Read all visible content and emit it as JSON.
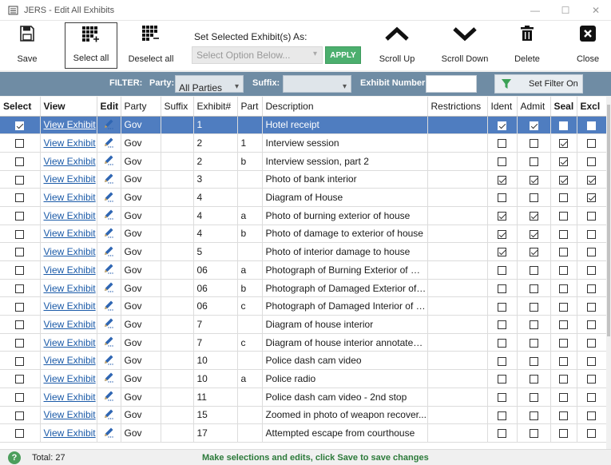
{
  "window": {
    "title": "JERS - Edit All Exhibits",
    "minimize": "—",
    "maximize": "☐",
    "close": "✕"
  },
  "toolbar": {
    "save": "Save",
    "select_all": "Select all",
    "deselect_all": "Deselect all",
    "set_selected_label": "Set Selected Exhibit(s) As:",
    "select_placeholder": "Select Option Below...",
    "apply": "APPLY",
    "scroll_up": "Scroll Up",
    "scroll_down": "Scroll Down",
    "delete": "Delete",
    "close": "Close"
  },
  "filter": {
    "label": "FILTER:",
    "party_label": "Party:",
    "party_value": "All Parties",
    "suffix_label": "Suffix:",
    "suffix_value": "",
    "exhibit_number_label": "Exhibit Number:",
    "exhibit_number_value": "",
    "set_filter": "Set Filter On"
  },
  "columns": [
    "Select",
    "View",
    "Edit",
    "Party",
    "Suffix",
    "Exhibit#",
    "Part",
    "Description",
    "Restrictions",
    "Ident",
    "Admit",
    "Seal",
    "Excl"
  ],
  "rows": [
    {
      "selected": true,
      "view": "View Exhibit",
      "party": "Gov",
      "suffix": "",
      "exhibit": "1",
      "part": "",
      "description": "Hotel receipt",
      "restrictions": "",
      "ident": true,
      "admit": true,
      "seal": false,
      "excl": false
    },
    {
      "selected": false,
      "view": "View Exhibit",
      "party": "Gov",
      "suffix": "",
      "exhibit": "2",
      "part": "1",
      "description": "Interview session",
      "restrictions": "",
      "ident": false,
      "admit": false,
      "seal": true,
      "excl": false
    },
    {
      "selected": false,
      "view": "View Exhibit",
      "party": "Gov",
      "suffix": "",
      "exhibit": "2",
      "part": "b",
      "description": "Interview session, part 2",
      "restrictions": "",
      "ident": false,
      "admit": false,
      "seal": true,
      "excl": false
    },
    {
      "selected": false,
      "view": "View Exhibit",
      "party": "Gov",
      "suffix": "",
      "exhibit": "3",
      "part": "",
      "description": "Photo of bank interior",
      "restrictions": "",
      "ident": true,
      "admit": true,
      "seal": true,
      "excl": true
    },
    {
      "selected": false,
      "view": "View Exhibit",
      "party": "Gov",
      "suffix": "",
      "exhibit": "4",
      "part": "",
      "description": "Diagram of House",
      "restrictions": "",
      "ident": false,
      "admit": false,
      "seal": false,
      "excl": true
    },
    {
      "selected": false,
      "view": "View Exhibit",
      "party": "Gov",
      "suffix": "",
      "exhibit": "4",
      "part": "a",
      "description": "Photo of burning exterior of house",
      "restrictions": "",
      "ident": true,
      "admit": true,
      "seal": false,
      "excl": false
    },
    {
      "selected": false,
      "view": "View Exhibit",
      "party": "Gov",
      "suffix": "",
      "exhibit": "4",
      "part": "b",
      "description": "Photo of damage to exterior of house",
      "restrictions": "",
      "ident": true,
      "admit": true,
      "seal": false,
      "excl": false
    },
    {
      "selected": false,
      "view": "View Exhibit",
      "party": "Gov",
      "suffix": "",
      "exhibit": "5",
      "part": "",
      "description": "Photo of interior damage to house",
      "restrictions": "",
      "ident": true,
      "admit": true,
      "seal": false,
      "excl": false
    },
    {
      "selected": false,
      "view": "View Exhibit",
      "party": "Gov",
      "suffix": "",
      "exhibit": "06",
      "part": "a",
      "description": "Photograph of Burning Exterior of Ho...",
      "restrictions": "",
      "ident": false,
      "admit": false,
      "seal": false,
      "excl": false
    },
    {
      "selected": false,
      "view": "View Exhibit",
      "party": "Gov",
      "suffix": "",
      "exhibit": "06",
      "part": "b",
      "description": "Photograph of Damaged Exterior of ...",
      "restrictions": "",
      "ident": false,
      "admit": false,
      "seal": false,
      "excl": false
    },
    {
      "selected": false,
      "view": "View Exhibit",
      "party": "Gov",
      "suffix": "",
      "exhibit": "06",
      "part": "c",
      "description": "Photograph of Damaged Interior of H...",
      "restrictions": "",
      "ident": false,
      "admit": false,
      "seal": false,
      "excl": false
    },
    {
      "selected": false,
      "view": "View Exhibit",
      "party": "Gov",
      "suffix": "",
      "exhibit": "7",
      "part": "",
      "description": "Diagram of house interior",
      "restrictions": "",
      "ident": false,
      "admit": false,
      "seal": false,
      "excl": false
    },
    {
      "selected": false,
      "view": "View Exhibit",
      "party": "Gov",
      "suffix": "",
      "exhibit": "7",
      "part": "c",
      "description": "Diagram of house interior annotated ...",
      "restrictions": "",
      "ident": false,
      "admit": false,
      "seal": false,
      "excl": false
    },
    {
      "selected": false,
      "view": "View Exhibit",
      "party": "Gov",
      "suffix": "",
      "exhibit": "10",
      "part": "",
      "description": "Police dash cam video",
      "restrictions": "",
      "ident": false,
      "admit": false,
      "seal": false,
      "excl": false
    },
    {
      "selected": false,
      "view": "View Exhibit",
      "party": "Gov",
      "suffix": "",
      "exhibit": "10",
      "part": "a",
      "description": "Police radio",
      "restrictions": "",
      "ident": false,
      "admit": false,
      "seal": false,
      "excl": false
    },
    {
      "selected": false,
      "view": "View Exhibit",
      "party": "Gov",
      "suffix": "",
      "exhibit": "11",
      "part": "",
      "description": "Police dash cam video - 2nd stop",
      "restrictions": "",
      "ident": false,
      "admit": false,
      "seal": false,
      "excl": false
    },
    {
      "selected": false,
      "view": "View Exhibit",
      "party": "Gov",
      "suffix": "",
      "exhibit": "15",
      "part": "",
      "description": "Zoomed in photo of weapon recover...",
      "restrictions": "",
      "ident": false,
      "admit": false,
      "seal": false,
      "excl": false
    },
    {
      "selected": false,
      "view": "View Exhibit",
      "party": "Gov",
      "suffix": "",
      "exhibit": "17",
      "part": "",
      "description": "Attempted escape from courthouse",
      "restrictions": "",
      "ident": false,
      "admit": false,
      "seal": false,
      "excl": false
    }
  ],
  "status": {
    "help": "?",
    "total": "Total: 27",
    "message": "Make selections and edits, click Save to save changes"
  },
  "colors": {
    "filter_bar": "#6f8ca4",
    "selected_row": "#4f7dc0",
    "apply_button": "#4caf6e",
    "status_message": "#2c7a3a",
    "link": "#1a5aa8"
  }
}
